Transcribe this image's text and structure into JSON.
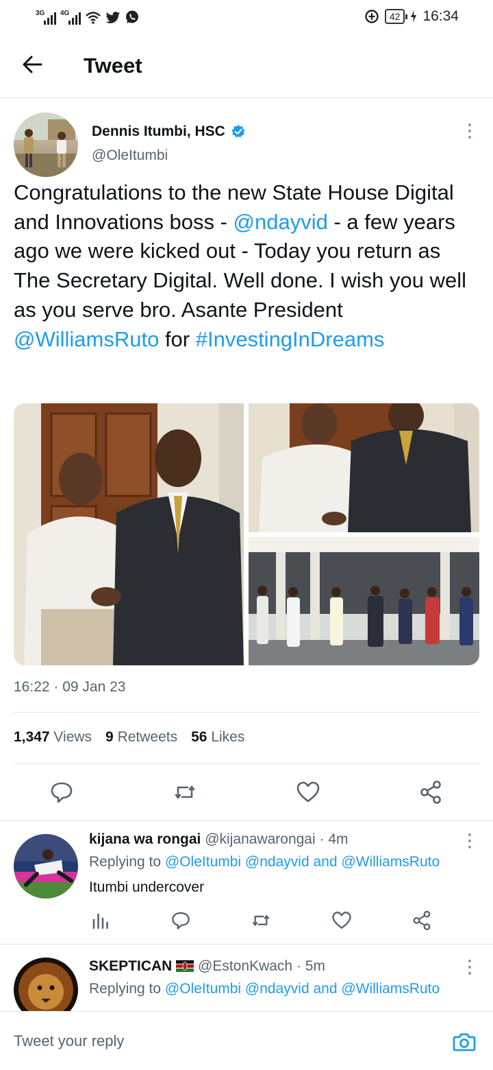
{
  "status_bar": {
    "network_1": "3G",
    "network_2": "4G",
    "battery": "42",
    "time": "16:34"
  },
  "header": {
    "title": "Tweet"
  },
  "tweet": {
    "author_name": "Dennis Itumbi, HSC",
    "author_handle": "@OleItumbi",
    "text_parts": {
      "p1": "Congratulations to the new State House Digital and Innovations boss - ",
      "m1": "@ndayvid",
      "p2": " - a few years ago we were kicked out - Today you return as The Secretary Digital. Well done. I wish you well as you serve bro. Asante President ",
      "m2": "@WilliamsRuto",
      "p3": " for ",
      "hashtag": "#InvestingInDreams"
    },
    "timestamp": "16:22 · 09 Jan 23",
    "stats": {
      "views_count": "1,347",
      "views_label": "Views",
      "retweets_count": "9",
      "retweets_label": "Retweets",
      "likes_count": "56",
      "likes_label": "Likes"
    }
  },
  "replies": [
    {
      "name": "kijana wa rongai",
      "handle": "@kijanawarongai",
      "time": "· 4m",
      "replying_label": "Replying to",
      "replying_to": "@OleItumbi @ndayvid and @WilliamsRuto",
      "text": "Itumbi undercover"
    },
    {
      "name": "SKEPTICAN",
      "handle": "@EstonKwach",
      "time": "· 5m",
      "replying_label": "Replying to",
      "replying_to": "@OleItumbi @ndayvid and @WilliamsRuto"
    }
  ],
  "reply_bar": {
    "placeholder": "Tweet your reply"
  },
  "colors": {
    "accent": "#1d9bf0",
    "muted": "#536471",
    "icon": "#536471"
  }
}
